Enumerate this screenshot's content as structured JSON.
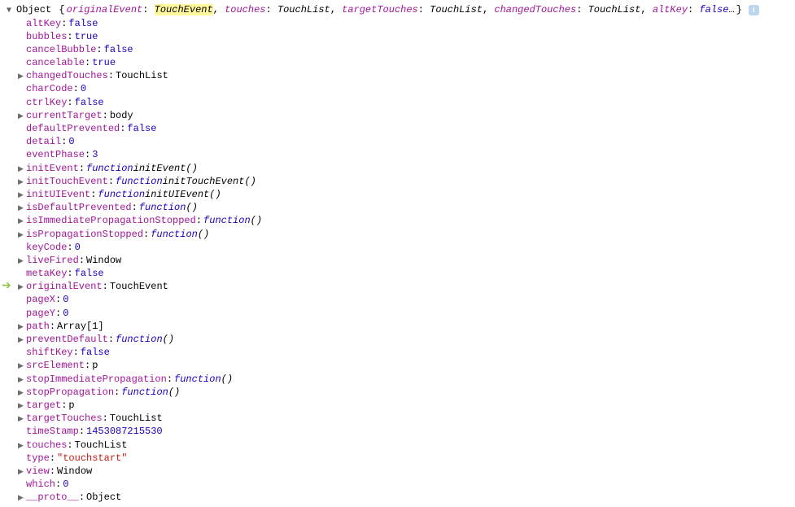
{
  "root": {
    "type_label": "Object",
    "summary": {
      "props": [
        {
          "name": "originalEvent",
          "valueType": "obj",
          "value": "TouchEvent",
          "highlight": true
        },
        {
          "name": "touches",
          "valueType": "obj",
          "value": "TouchList"
        },
        {
          "name": "targetTouches",
          "valueType": "obj",
          "value": "TouchList"
        },
        {
          "name": "changedTouches",
          "valueType": "obj",
          "value": "TouchList"
        },
        {
          "name": "altKey",
          "valueType": "bool",
          "value": "false"
        }
      ],
      "ellipsis": "…"
    }
  },
  "props": [
    {
      "arrow": "none",
      "name": "altKey",
      "valueType": "bool",
      "value": "false"
    },
    {
      "arrow": "none",
      "name": "bubbles",
      "valueType": "bool",
      "value": "true"
    },
    {
      "arrow": "none",
      "name": "cancelBubble",
      "valueType": "bool",
      "value": "false"
    },
    {
      "arrow": "none",
      "name": "cancelable",
      "valueType": "bool",
      "value": "true"
    },
    {
      "arrow": "right",
      "name": "changedTouches",
      "valueType": "obj",
      "value": "TouchList"
    },
    {
      "arrow": "none",
      "name": "charCode",
      "valueType": "num",
      "value": "0"
    },
    {
      "arrow": "none",
      "name": "ctrlKey",
      "valueType": "bool",
      "value": "false"
    },
    {
      "arrow": "right",
      "name": "currentTarget",
      "valueType": "obj",
      "value": "body"
    },
    {
      "arrow": "none",
      "name": "defaultPrevented",
      "valueType": "bool",
      "value": "false"
    },
    {
      "arrow": "none",
      "name": "detail",
      "valueType": "num",
      "value": "0"
    },
    {
      "arrow": "none",
      "name": "eventPhase",
      "valueType": "num",
      "value": "3"
    },
    {
      "arrow": "right",
      "name": "initEvent",
      "valueType": "fn",
      "value": "initEvent()"
    },
    {
      "arrow": "right",
      "name": "initTouchEvent",
      "valueType": "fn",
      "value": "initTouchEvent()"
    },
    {
      "arrow": "right",
      "name": "initUIEvent",
      "valueType": "fn",
      "value": "initUIEvent()"
    },
    {
      "arrow": "right",
      "name": "isDefaultPrevented",
      "valueType": "fn",
      "value": "()"
    },
    {
      "arrow": "right",
      "name": "isImmediatePropagationStopped",
      "valueType": "fn",
      "value": "()"
    },
    {
      "arrow": "right",
      "name": "isPropagationStopped",
      "valueType": "fn",
      "value": "()"
    },
    {
      "arrow": "none",
      "name": "keyCode",
      "valueType": "num",
      "value": "0"
    },
    {
      "arrow": "right",
      "name": "liveFired",
      "valueType": "obj",
      "value": "Window"
    },
    {
      "arrow": "none",
      "name": "metaKey",
      "valueType": "bool",
      "value": "false"
    },
    {
      "arrow": "right",
      "name": "originalEvent",
      "valueType": "obj",
      "value": "TouchEvent",
      "pointer": true
    },
    {
      "arrow": "none",
      "name": "pageX",
      "valueType": "num",
      "value": "0"
    },
    {
      "arrow": "none",
      "name": "pageY",
      "valueType": "num",
      "value": "0"
    },
    {
      "arrow": "right",
      "name": "path",
      "valueType": "obj",
      "value": "Array[1]"
    },
    {
      "arrow": "right",
      "name": "preventDefault",
      "valueType": "fn",
      "value": "()"
    },
    {
      "arrow": "none",
      "name": "shiftKey",
      "valueType": "bool",
      "value": "false"
    },
    {
      "arrow": "right",
      "name": "srcElement",
      "valueType": "obj",
      "value": "p"
    },
    {
      "arrow": "right",
      "name": "stopImmediatePropagation",
      "valueType": "fn",
      "value": "()"
    },
    {
      "arrow": "right",
      "name": "stopPropagation",
      "valueType": "fn",
      "value": "()"
    },
    {
      "arrow": "right",
      "name": "target",
      "valueType": "obj",
      "value": "p"
    },
    {
      "arrow": "right",
      "name": "targetTouches",
      "valueType": "obj",
      "value": "TouchList"
    },
    {
      "arrow": "none",
      "name": "timeStamp",
      "valueType": "num",
      "value": "1453087215530"
    },
    {
      "arrow": "right",
      "name": "touches",
      "valueType": "obj",
      "value": "TouchList"
    },
    {
      "arrow": "none",
      "name": "type",
      "valueType": "str",
      "value": "\"touchstart\""
    },
    {
      "arrow": "right",
      "name": "view",
      "valueType": "obj",
      "value": "Window"
    },
    {
      "arrow": "none",
      "name": "which",
      "valueType": "num",
      "value": "0"
    },
    {
      "arrow": "right",
      "name": "__proto__",
      "valueType": "obj",
      "value": "Object"
    }
  ],
  "function_keyword": "function"
}
